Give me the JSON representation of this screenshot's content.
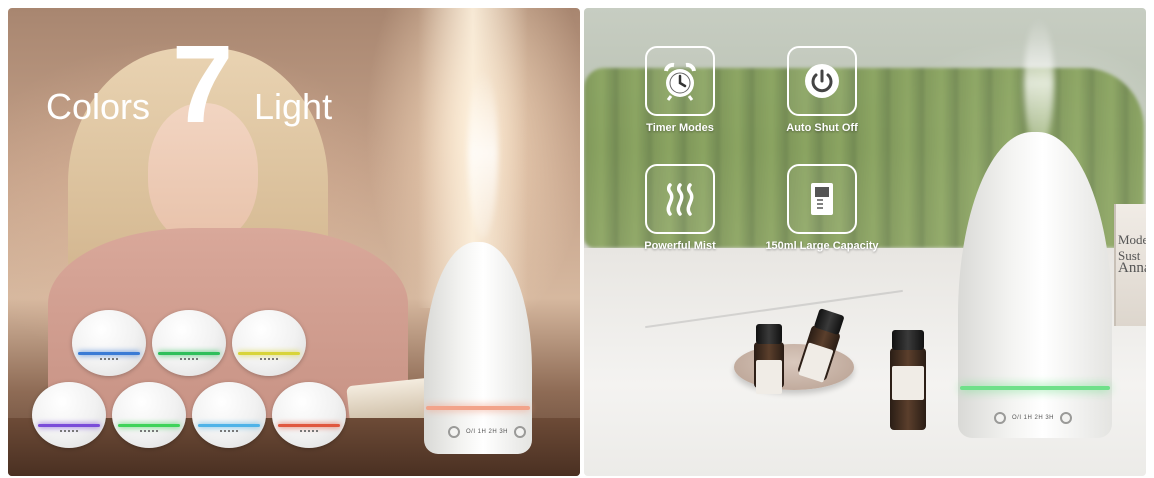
{
  "left_panel": {
    "headline": {
      "word_1": "Colors",
      "number": "7",
      "word_2": "Light"
    },
    "color_variants": [
      "blue",
      "green",
      "yellow",
      "purple",
      "green",
      "light-blue",
      "red"
    ],
    "ring_colors": [
      "#3a7bd5",
      "#2fbf5b",
      "#d8d43a",
      "#7a4cd9",
      "#3fd35a",
      "#4fb3e8",
      "#e0573f"
    ],
    "diffuser_controls": "O/I 1H 2H 3H",
    "diffuser_band_color": "#f2a38a"
  },
  "right_panel": {
    "features": [
      {
        "label": "Timer Modes",
        "icon": "alarm-clock-icon"
      },
      {
        "label": "Auto Shut Off",
        "icon": "power-icon"
      },
      {
        "label": "Powerful Mist",
        "icon": "steam-icon"
      },
      {
        "label": "150ml Large Capacity",
        "icon": "water-tank-icon"
      }
    ],
    "book_text_1": "Modern Sust",
    "book_text_2": "Anna",
    "diffuser_controls": "O/I 1H 2H 3H",
    "diffuser_band_color": "#6fe08a"
  }
}
